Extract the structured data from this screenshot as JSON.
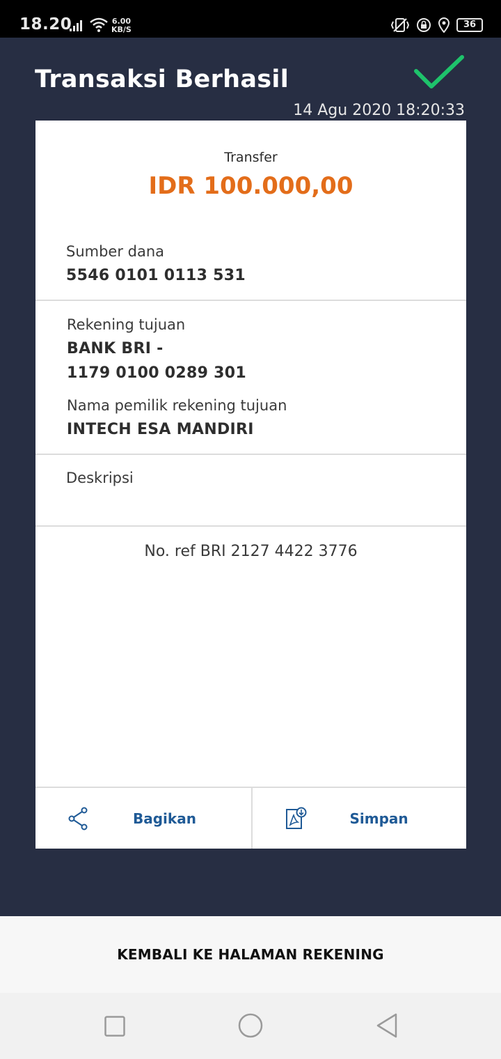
{
  "status_bar": {
    "time": "18.20",
    "speed_value": "6.00",
    "speed_unit": "KB/S",
    "battery": "36"
  },
  "header": {
    "title": "Transaksi Berhasil",
    "datetime": "14 Agu 2020 18:20:33"
  },
  "receipt": {
    "type": "Transfer",
    "amount": "IDR 100.000,00",
    "source_label": "Sumber dana",
    "source_value": "5546 0101 0113 531",
    "dest_label": "Rekening tujuan",
    "dest_bank": "BANK BRI -",
    "dest_account": "1179 0100 0289 301",
    "dest_owner_label": "Nama pemilik rekening tujuan",
    "dest_owner_value": "INTECH ESA MANDIRI",
    "description_label": "Deskripsi",
    "reference": "No. ref BRI 2127 4422 3776"
  },
  "actions": {
    "share_label": "Bagikan",
    "save_label": "Simpan"
  },
  "footer": {
    "back_button_label": "KEMBALI KE HALAMAN REKENING"
  },
  "colors": {
    "background": "#272e43",
    "accent_amount": "#e36d1a",
    "success_check": "#1ec36b",
    "action_text": "#1f5a96"
  },
  "icons": {
    "success": "check-icon",
    "share": "share-icon",
    "save": "pdf-download-icon"
  }
}
